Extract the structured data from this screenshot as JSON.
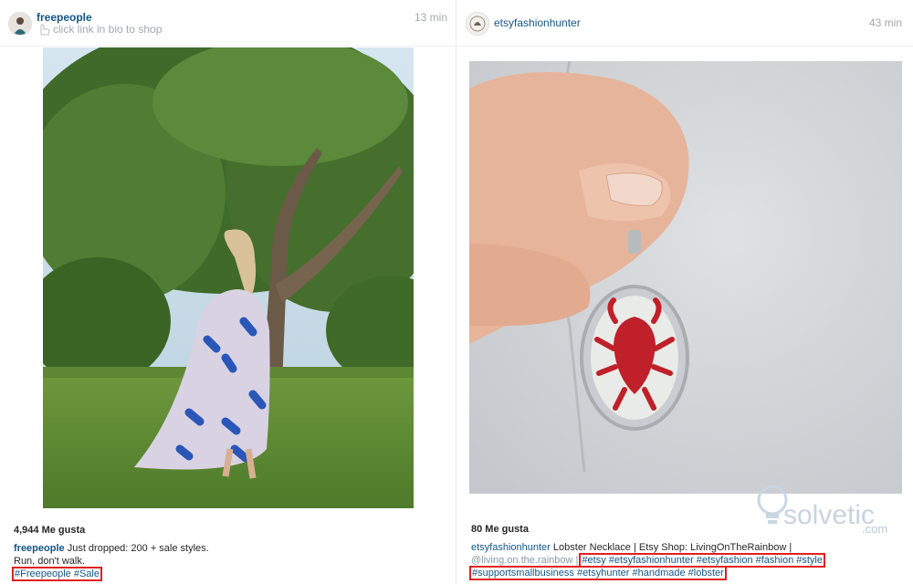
{
  "posts": [
    {
      "username": "freepeople",
      "location": "click link in bio to shop",
      "time": "13 min",
      "likes": "4,944 Me gusta",
      "caption_user": "freepeople",
      "caption_line1": "Just dropped: 200 + sale styles.",
      "caption_line2": "Run, don't walk.",
      "hashtags": "#Freepeople #Sale",
      "photo": "woman-in-dress-running-on-lawn"
    },
    {
      "username": "etsyfashionhunter",
      "time": "43 min",
      "likes": "80 Me gusta",
      "caption_user": "etsyfashionhunter",
      "caption_line1": "Lobster Necklace | Etsy Shop: LivingOnTheRainbow |",
      "mention": "@living.on.the.rainbow |",
      "hashtags_line1": "#etsy #etsyfashionhunter #etsyfashion #fashion #style",
      "hashtags_line2": "#supportsmallbusiness #etsyhunter #handmade #lobster",
      "photo": "hand-holding-lobster-pendant-necklace"
    }
  ],
  "watermark": {
    "brand": "solvetic",
    "suffix": ".com"
  },
  "colors": {
    "link": "#125688",
    "highlight_box": "#e02020",
    "meta": "#a5a7aa"
  }
}
